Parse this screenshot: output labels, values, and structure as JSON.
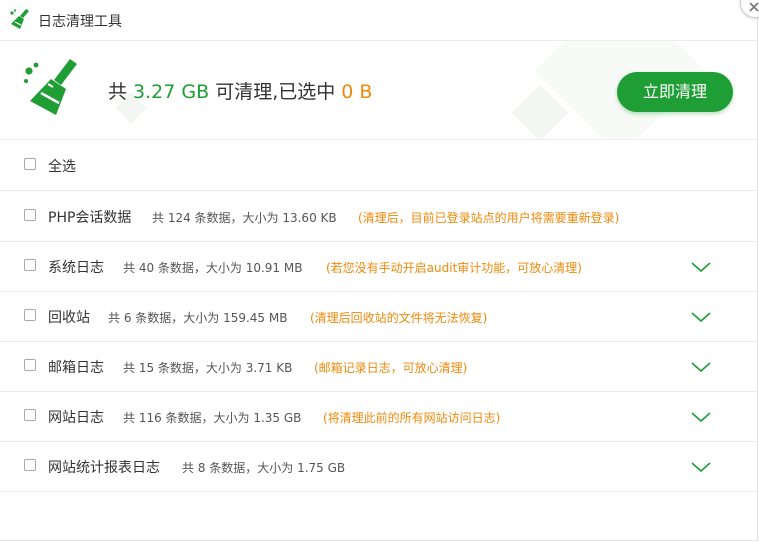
{
  "window": {
    "title": "日志清理工具",
    "close_icon": "close-icon"
  },
  "header": {
    "prefix": "共 ",
    "total_size": "3.27 GB",
    "middle": " 可清理,已选中 ",
    "selected_size": "0 B",
    "clean_button": "立即清理",
    "accent_green": "#1f9e35",
    "accent_orange": "#f0890a"
  },
  "select_all": {
    "label": "全选",
    "checked": false
  },
  "items": [
    {
      "name": "PHP会话数据",
      "stats": "共 124 条数据，大小为 13.60 KB",
      "note": "(清理后，目前已登录站点的用户将需要重新登录)",
      "checked": false,
      "expandable": false
    },
    {
      "name": "系统日志",
      "stats": "共 40 条数据，大小为 10.91 MB",
      "note": "(若您没有手动开启audit审计功能，可放心清理)",
      "checked": false,
      "expandable": true
    },
    {
      "name": "回收站",
      "stats": "共 6 条数据，大小为 159.45 MB",
      "note": "(清理后回收站的文件将无法恢复)",
      "checked": false,
      "expandable": true
    },
    {
      "name": "邮箱日志",
      "stats": "共 15 条数据，大小为 3.71 KB",
      "note": "(邮箱记录日志，可放心清理)",
      "checked": false,
      "expandable": true
    },
    {
      "name": "网站日志",
      "stats": "共 116 条数据，大小为 1.35 GB",
      "note": "(将清理此前的所有网站访问日志)",
      "checked": false,
      "expandable": true
    },
    {
      "name": "网站统计报表日志",
      "stats": "共 8 条数据，大小为 1.75 GB",
      "note": "",
      "checked": false,
      "expandable": true
    }
  ]
}
